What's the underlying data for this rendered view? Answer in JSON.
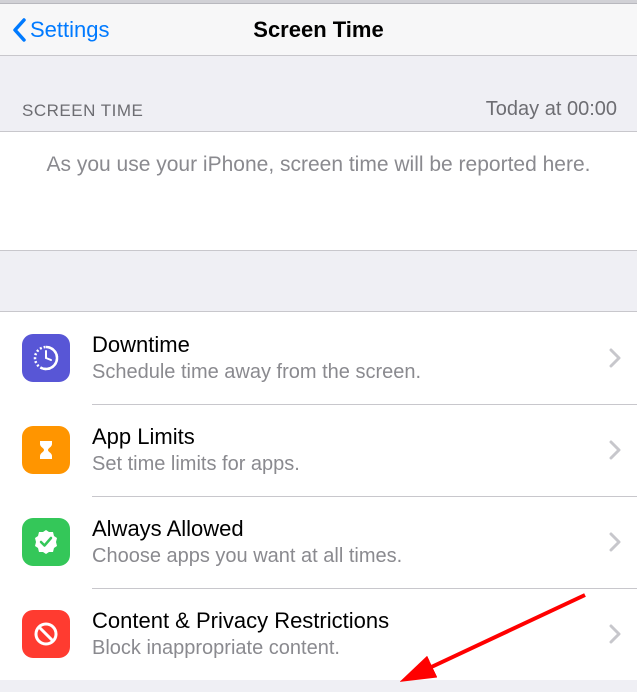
{
  "nav": {
    "back_label": "Settings",
    "title": "Screen Time"
  },
  "section": {
    "header_left": "Screen Time",
    "header_right": "Today at 00:00",
    "info_text": "As you use your iPhone, screen time will be reported here."
  },
  "rows": [
    {
      "icon": "clock-icon",
      "title": "Downtime",
      "subtitle": "Schedule time away from the screen."
    },
    {
      "icon": "hourglass-icon",
      "title": "App Limits",
      "subtitle": "Set time limits for apps."
    },
    {
      "icon": "check-badge-icon",
      "title": "Always Allowed",
      "subtitle": "Choose apps you want at all times."
    },
    {
      "icon": "no-entry-icon",
      "title": "Content & Privacy Restrictions",
      "subtitle": "Block inappropriate content."
    }
  ]
}
